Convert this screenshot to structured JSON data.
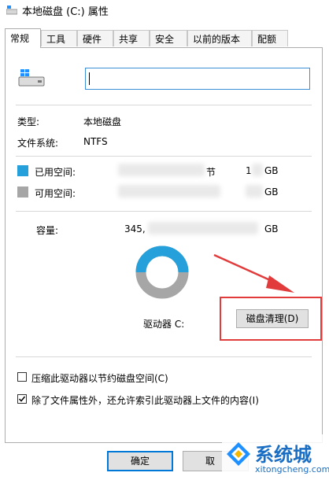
{
  "window": {
    "title": "本地磁盘 (C:) 属性"
  },
  "tabs": [
    {
      "label": "常规",
      "active": true
    },
    {
      "label": "工具"
    },
    {
      "label": "硬件"
    },
    {
      "label": "共享"
    },
    {
      "label": "安全"
    },
    {
      "label": "以前的版本"
    },
    {
      "label": "配额"
    }
  ],
  "general": {
    "drive_name_value": "",
    "type_label": "类型:",
    "type_value": "本地磁盘",
    "fs_label": "文件系统:",
    "fs_value": "NTFS",
    "used_label": "已用空间:",
    "used_bytes_suffix": "节",
    "used_gb_prefix": "1",
    "used_gb": "GB",
    "free_label": "可用空间:",
    "free_gb": "GB",
    "capacity_label": "容量:",
    "capacity_prefix": "345,",
    "capacity_gb": "GB",
    "drive_label": "驱动器 C:",
    "cleanup_button": "磁盘清理(D)",
    "compress_label": "压缩此驱动器以节约磁盘空间(C)",
    "compress_checked": false,
    "index_label": "除了文件属性外，还允许索引此驱动器上文件的内容(I)",
    "index_checked": true
  },
  "buttons": {
    "ok": "确定",
    "cancel": "取"
  },
  "colors": {
    "used": "#26a0da",
    "free": "#a6a6a6",
    "highlight": "#e23b3b",
    "accent": "#0078d7"
  },
  "watermark": {
    "brand": "系统城",
    "url": "xitongcheng.com"
  }
}
